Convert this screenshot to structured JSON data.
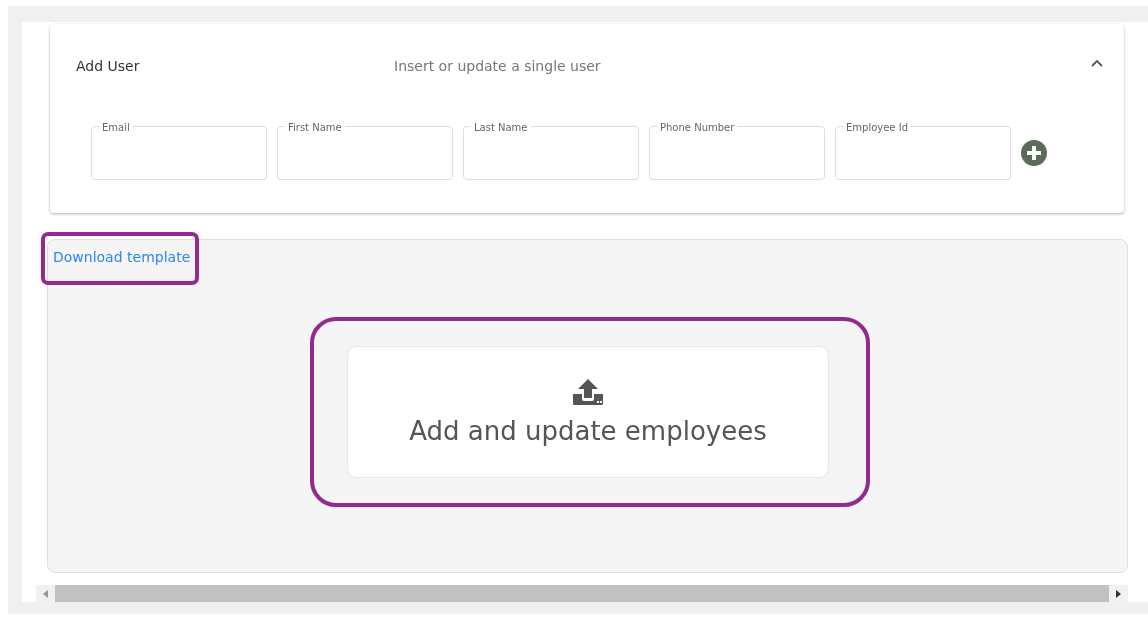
{
  "add_user": {
    "title": "Add User",
    "subtitle": "Insert or update a single user",
    "expanded": true,
    "fields": [
      {
        "label": "Email"
      },
      {
        "label": "First Name"
      },
      {
        "label": "Last Name"
      },
      {
        "label": "Phone Number"
      },
      {
        "label": "Employee Id"
      }
    ]
  },
  "upload": {
    "download_link": "Download template",
    "drop_label": "Add and update employees"
  }
}
